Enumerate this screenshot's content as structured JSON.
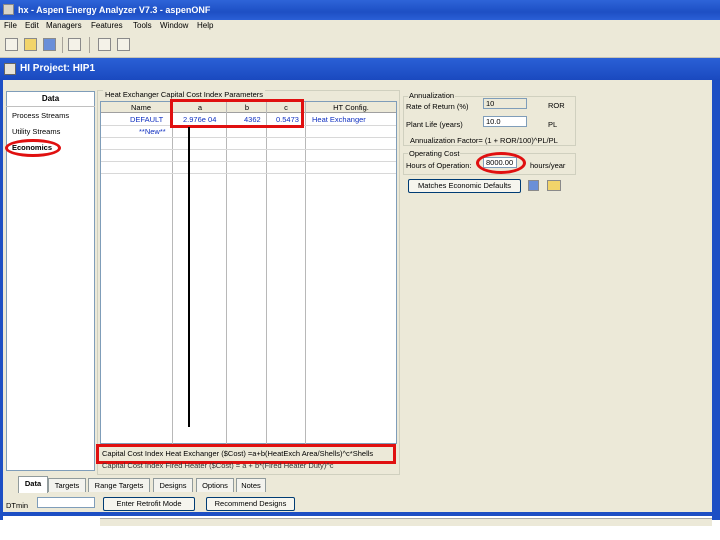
{
  "window": {
    "title": "hx - Aspen Energy Analyzer V7.3 - aspenONF"
  },
  "menu": [
    "File",
    "Edit",
    "Managers",
    "Features",
    "Tools",
    "Window",
    "Help"
  ],
  "project": {
    "title": "HI Project:  HIP1"
  },
  "data_panel": {
    "header": "Data",
    "items": [
      "Process Streams",
      "Utility Streams",
      "Economics"
    ]
  },
  "grid": {
    "group_title": "Heat Exchanger Capital Cost Index Parameters",
    "columns": [
      "Name",
      "a",
      "b",
      "c",
      "HT Config."
    ],
    "rows": [
      {
        "name": "DEFAULT",
        "a": "2.976e 04",
        "b": "4362",
        "c": "0.5473",
        "config": "Heat Exchanger"
      },
      {
        "name": "**New**",
        "a": "",
        "b": "",
        "c": "",
        "config": ""
      }
    ],
    "formula_exchanger": "Capital Cost Index Heat Exchanger ($Cost) =a+b(HeatExch Area/Shells)^c*Shells",
    "formula_heater": "Capital Cost Index Fired Heater ($Cost) = a + b*(Fired Heater Duty)^c"
  },
  "annualization": {
    "title": "Annualization",
    "ror_label": "Rate of Return (%)",
    "ror_value": "10",
    "ror_unit": "ROR",
    "plant_life_label": "Plant Life (years)",
    "plant_life_value": "10.0",
    "plant_life_unit": "PL",
    "factor_text": "Annualization Factor= (1 + ROR/100)^PL/PL"
  },
  "operating_cost": {
    "title": "Operating Cost",
    "hours_label": "Hours of Operation:",
    "hours_value": "8000.00",
    "hours_unit": "hours/year"
  },
  "economic_defaults_button": "Matches Economic Defaults",
  "tabs": [
    "Data",
    "Targets",
    "Range Targets",
    "Designs",
    "Options",
    "Notes"
  ],
  "bottom": {
    "dtmin_label": "DTmin",
    "dtmin_value": "",
    "retrofit_button": "Enter Retrofit Mode",
    "recommend_button": "Recommend Designs"
  }
}
